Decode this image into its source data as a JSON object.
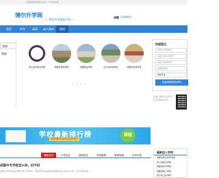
{
  "top_strip": {
    "text": "全国各种学校招生资讯  ·  升学信息网"
  },
  "header": {
    "logo": "博尔升学网",
    "slogan": "— 招生升学服务平台 —",
    "city": "成都",
    "switch_label": "[切换城市]"
  },
  "nav": {
    "items": [
      {
        "label": "首页"
      },
      {
        "label": "中专"
      },
      {
        "label": "高职"
      },
      {
        "label": "成人高考"
      },
      {
        "label": "院校"
      }
    ]
  },
  "left_menu": {
    "items": [
      {
        "label": "学校"
      },
      {
        "label": "院校"
      }
    ]
  },
  "schools": [
    {
      "name": "浙江金华职业学院"
    },
    {
      "name": "成都市技师学院"
    },
    {
      "name": "成都职业学院"
    },
    {
      "name": "四川省商贸学校"
    },
    {
      "name": "成都市财贸学校"
    }
  ],
  "pagination": "• • • •",
  "signup": {
    "title": "快速登记",
    "name_placeholder": "请输入你的姓名",
    "phone_placeholder": "请输入你的手机号",
    "school_placeholder": "请输入意向学校",
    "type_placeholder": "请选择类别",
    "major_value": "财经专业",
    "submit_label": "免费获取报名资料"
  },
  "qr": {
    "text": "扫描二维码 关注升学网 获取最新资讯"
  },
  "banner": {
    "title": "学校最新排行榜",
    "subtitle": "给你最专业的学校排行",
    "badge": "择校"
  },
  "tabs": [
    {
      "label": "最新资讯"
    },
    {
      "label": "中专招生"
    },
    {
      "label": "高职招生"
    },
    {
      "label": "学校新闻"
    },
    {
      "label": "报考指南"
    },
    {
      "label": "升学问答"
    }
  ],
  "article": {
    "title": "成都中专学校怎么样，好不好",
    "snippet": "成都中专学校是目前较为热门的学校，很多同学在选择的时候都会关注学校怎么样、好不好等问题……"
  },
  "right_list": {
    "title": "最新加入学校",
    "items": [
      {
        "label": "成都某职业技术学校"
      },
      {
        "label": "四川某职业学院"
      },
      {
        "label": "成都某中专学校"
      },
      {
        "label": "成都某技工学校"
      },
      {
        "label": "四川某卫生学校"
      }
    ]
  }
}
